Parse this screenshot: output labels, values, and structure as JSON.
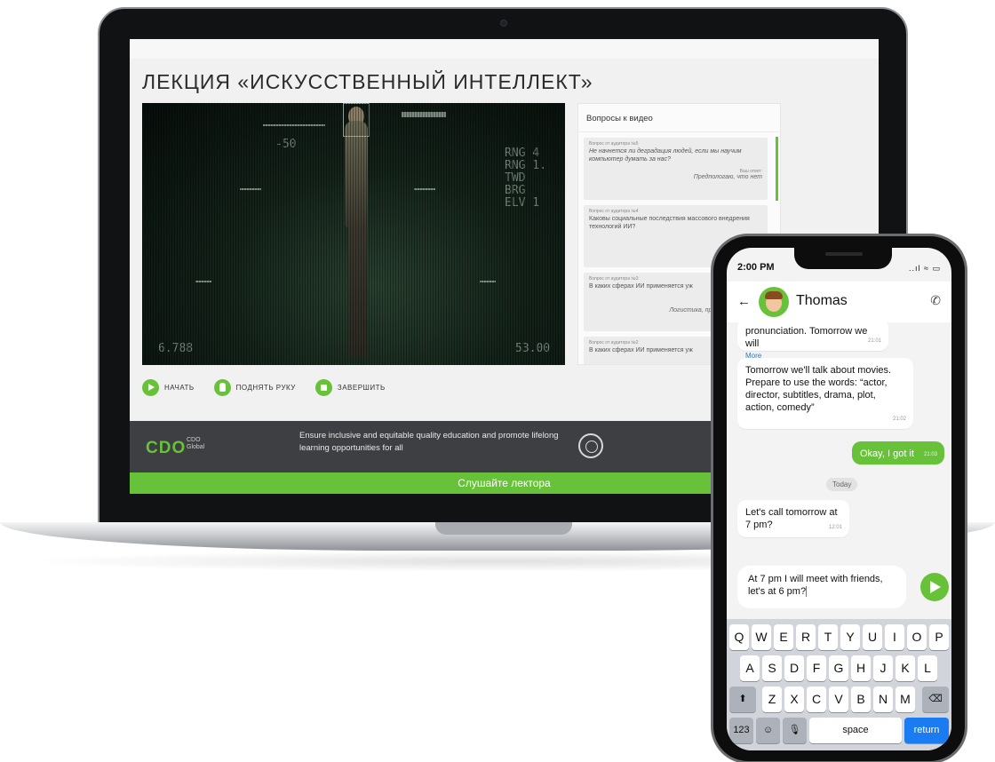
{
  "laptop": {
    "lecture_title": "ЛЕКЦИЯ «ИСКУССТВЕННЫЙ ИНТЕЛЛЕКТ»",
    "video": {
      "hud_left": "-50",
      "hud_right": [
        "RNG  4",
        "RNG  1.",
        "TWD",
        "BRG",
        "ELV  1"
      ],
      "hud_bottom_left": "6.788",
      "hud_bottom_right": "53.00"
    },
    "controls": [
      {
        "label": "НАЧАТЬ",
        "icon": "play-icon"
      },
      {
        "label": "ПОДНЯТЬ РУКУ",
        "icon": "hand-icon"
      },
      {
        "label": "ЗАВЕРШИТЬ",
        "icon": "stop-icon"
      }
    ],
    "questions_panel": {
      "title": "Вопросы к видео",
      "questions": [
        {
          "meta": "Вопрос от аудитора №5",
          "text": "Не начнется ли деградация людей, если мы научим компьютер думать за нас?",
          "answer_label": "Ваш ответ:",
          "answer": "Предпологаю, что нет"
        },
        {
          "meta": "Вопрос от аудитора №4",
          "text": "Каковы социальные последствия массового внедрения технологий ИИ?",
          "answer_label": "",
          "answer": "Поде"
        },
        {
          "meta": "Вопрос от аудитора №3",
          "text": "В каких сферах ИИ применяется уж",
          "answer_label": "",
          "answer": "Логистика, прогнозировать ро"
        },
        {
          "meta": "Вопрос от аудитора №2",
          "text": "В каких сферах ИИ применяется уж",
          "answer_label": "",
          "answer": ""
        }
      ]
    },
    "footer": {
      "logo": "CDO",
      "logo_sub_1": "CDO",
      "logo_sub_2": "Global",
      "mission": "Ensure inclusive and equitable quality education and promote lifelong learning opportunities for all"
    },
    "banner": "Слушайте лектора"
  },
  "phone": {
    "status_time": "2:00 PM",
    "status_icons": "..ıl ≈ ▭",
    "contact_name": "Thomas",
    "messages": [
      {
        "text": "pronunciation. Tomorrow we will",
        "more": "More",
        "time": "21:01",
        "dir": "in"
      },
      {
        "text": "Tomorrow we'll talk about movies. Prepare to use the words: “actor, director, subtitles, drama, plot, action, comedy”",
        "time": "21:02",
        "dir": "in"
      },
      {
        "text": "Okay, I got it",
        "time": "21:03",
        "dir": "out"
      },
      {
        "text": "Let's call tomorrow at 7 pm?",
        "time": "12:01",
        "dir": "in"
      }
    ],
    "date_chip": "Today",
    "composer_text": "At 7 pm I will meet with friends, let's at 6 pm?",
    "keyboard": {
      "row1": [
        "Q",
        "W",
        "E",
        "R",
        "T",
        "Y",
        "U",
        "I",
        "O",
        "P"
      ],
      "row2": [
        "A",
        "S",
        "D",
        "F",
        "G",
        "H",
        "J",
        "K",
        "L"
      ],
      "row3": [
        "Z",
        "X",
        "C",
        "V",
        "B",
        "N",
        "M"
      ],
      "shift": "⬆",
      "backspace": "⌫",
      "numbers": "123",
      "emoji": "☺",
      "mic": "🎙",
      "space": "space",
      "return": "return"
    }
  }
}
